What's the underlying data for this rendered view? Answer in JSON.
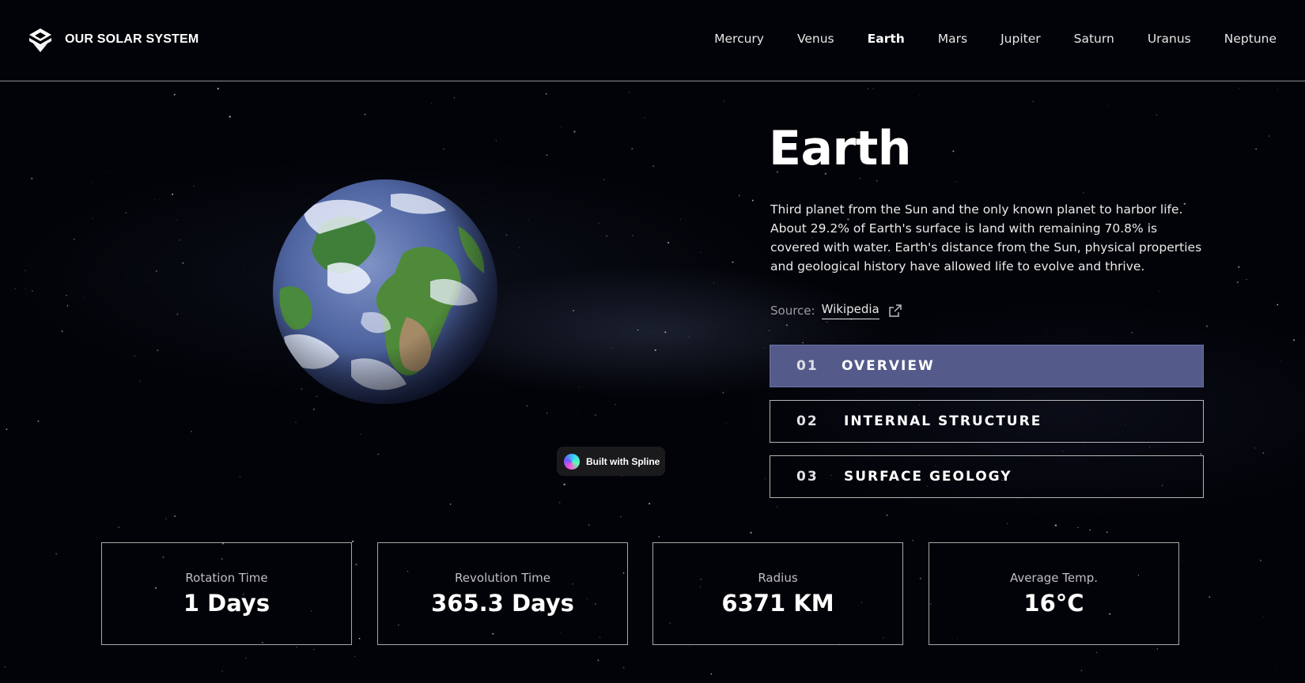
{
  "header": {
    "brand": "OUR SOLAR SYSTEM",
    "nav": [
      {
        "label": "Mercury",
        "active": false
      },
      {
        "label": "Venus",
        "active": false
      },
      {
        "label": "Earth",
        "active": true
      },
      {
        "label": "Mars",
        "active": false
      },
      {
        "label": "Jupiter",
        "active": false
      },
      {
        "label": "Saturn",
        "active": false
      },
      {
        "label": "Uranus",
        "active": false
      },
      {
        "label": "Neptune",
        "active": false
      }
    ]
  },
  "planet": {
    "name": "Earth",
    "description": "Third planet from the Sun and the only known planet to harbor life. About 29.2% of Earth's surface is land with remaining 70.8% is covered with water. Earth's distance from the Sun, physical properties and geological history have allowed life to evolve and thrive.",
    "source_label": "Source:",
    "source_link": "Wikipedia",
    "image_icon": "earth-globe"
  },
  "badge": {
    "label": "Built with Spline"
  },
  "tabs": [
    {
      "num": "01",
      "label": "OVERVIEW",
      "active": true
    },
    {
      "num": "02",
      "label": "INTERNAL STRUCTURE",
      "active": false
    },
    {
      "num": "03",
      "label": "SURFACE GEOLOGY",
      "active": false
    }
  ],
  "stats": [
    {
      "label": "Rotation Time",
      "value": "1 Days"
    },
    {
      "label": "Revolution Time",
      "value": "365.3 Days"
    },
    {
      "label": "Radius",
      "value": "6371 KM"
    },
    {
      "label": "Average Temp.",
      "value": "16°C"
    }
  ],
  "colors": {
    "background": "#020308",
    "accent_tab": "#545b8b",
    "text": "#ffffff",
    "muted_text": "#9a9aa2"
  }
}
